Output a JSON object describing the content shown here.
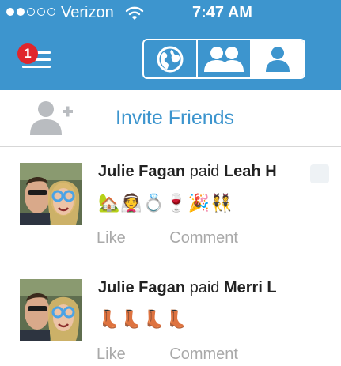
{
  "status_bar": {
    "signal_filled": 2,
    "signal_total": 5,
    "carrier": "Verizon",
    "time": "7:47 AM"
  },
  "nav": {
    "menu_badge": "1",
    "tabs": [
      {
        "name": "globe",
        "icon": "globe-icon",
        "active": false
      },
      {
        "name": "friends",
        "icon": "friends-icon",
        "active": false
      },
      {
        "name": "me",
        "icon": "person-icon",
        "active": true
      }
    ]
  },
  "invite": {
    "label": "Invite Friends"
  },
  "feed": [
    {
      "payer": "Julie Fagan",
      "verb": "paid",
      "payee": "Leah H",
      "note": "🏡👰💍🍷🎉👯",
      "like_label": "Like",
      "comment_label": "Comment"
    },
    {
      "payer": "Julie Fagan",
      "verb": "paid",
      "payee": "Merri L",
      "note": "👢👢👢👢",
      "like_label": "Like",
      "comment_label": "Comment"
    }
  ],
  "colors": {
    "brand_blue": "#3d95ce",
    "badge_red": "#e0262c",
    "action_gray": "#a9a9a9"
  }
}
